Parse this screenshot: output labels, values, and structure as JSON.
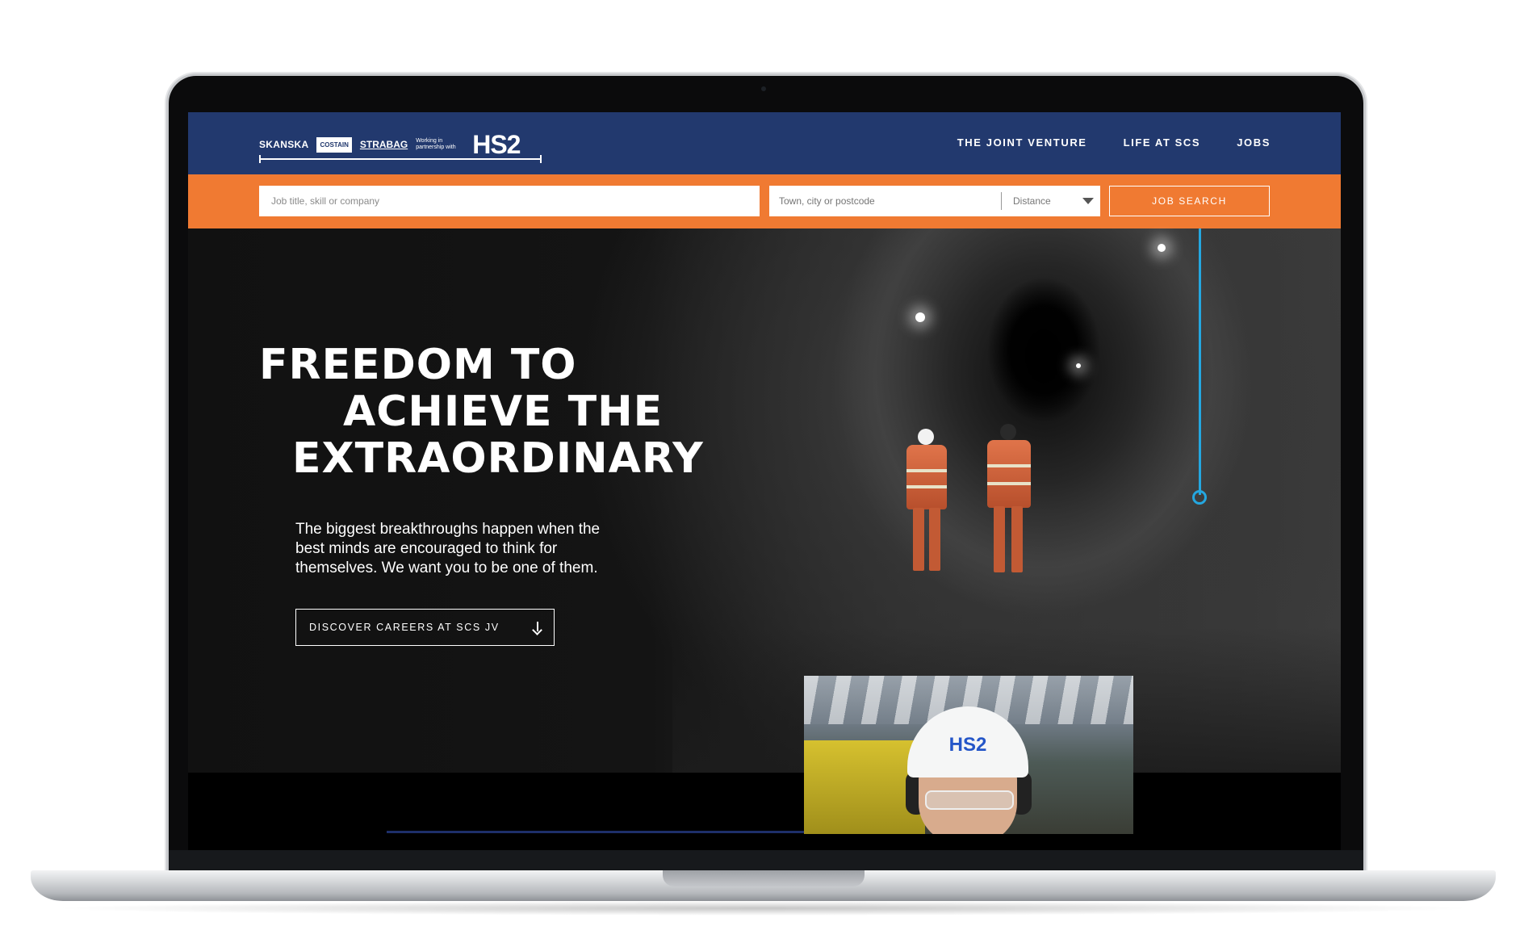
{
  "brand": {
    "skanska": "SKANSKA",
    "costain": "COSTAIN",
    "strabag": "STRABAG",
    "working_with": "Working in partnership with",
    "hs2": "HS2"
  },
  "nav": {
    "items": [
      "THE JOINT VENTURE",
      "LIFE AT SCS",
      "JOBS"
    ]
  },
  "search": {
    "job_placeholder": "Job title, skill or company",
    "location_placeholder": "Town, city or postcode",
    "distance_label": "Distance",
    "button_label": "JOB SEARCH"
  },
  "hero": {
    "title_line1": "FREEDOM TO",
    "title_line2": "ACHIEVE THE",
    "title_line3": "EXTRAORDINARY",
    "body": "The biggest breakthroughs happen when the best minds are encouraged to think for themselves. We want you to be one of them.",
    "cta_label": "DISCOVER CAREERS AT SCS JV"
  },
  "video": {
    "helmet_text": "HS2"
  },
  "colors": {
    "header_blue": "#22396e",
    "search_orange": "#f07a32",
    "cable_blue": "#24a7e0"
  }
}
